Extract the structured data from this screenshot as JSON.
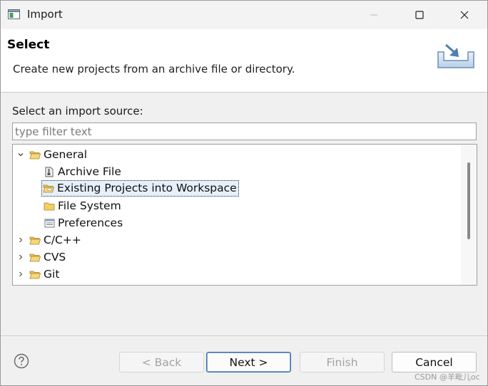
{
  "window": {
    "title": "Import",
    "colors": {
      "selection_bg": "#e6f0fb",
      "default_button_border": "#3b6ea8"
    }
  },
  "banner": {
    "title": "Select",
    "description": "Create new projects from an archive file or directory."
  },
  "source": {
    "label": "Select an import source:",
    "filter_placeholder": "type filter text",
    "filter_value": ""
  },
  "tree": {
    "items": [
      {
        "label": "General",
        "icon": "folder-open-icon",
        "expanded": true
      },
      {
        "label": "Archive File",
        "icon": "archive-file-icon"
      },
      {
        "label": "Existing Projects into Workspace",
        "icon": "folder-open-icon",
        "selected": true
      },
      {
        "label": "File System",
        "icon": "folder-icon"
      },
      {
        "label": "Preferences",
        "icon": "preferences-icon"
      },
      {
        "label": "C/C++",
        "icon": "folder-icon",
        "expanded": false
      },
      {
        "label": "CVS",
        "icon": "folder-icon",
        "expanded": false
      },
      {
        "label": "Git",
        "icon": "folder-icon",
        "expanded": false
      }
    ]
  },
  "footer": {
    "back": "< Back",
    "next": "Next >",
    "finish": "Finish",
    "cancel": "Cancel"
  },
  "watermark": "CSDN @羊毗儿oc"
}
